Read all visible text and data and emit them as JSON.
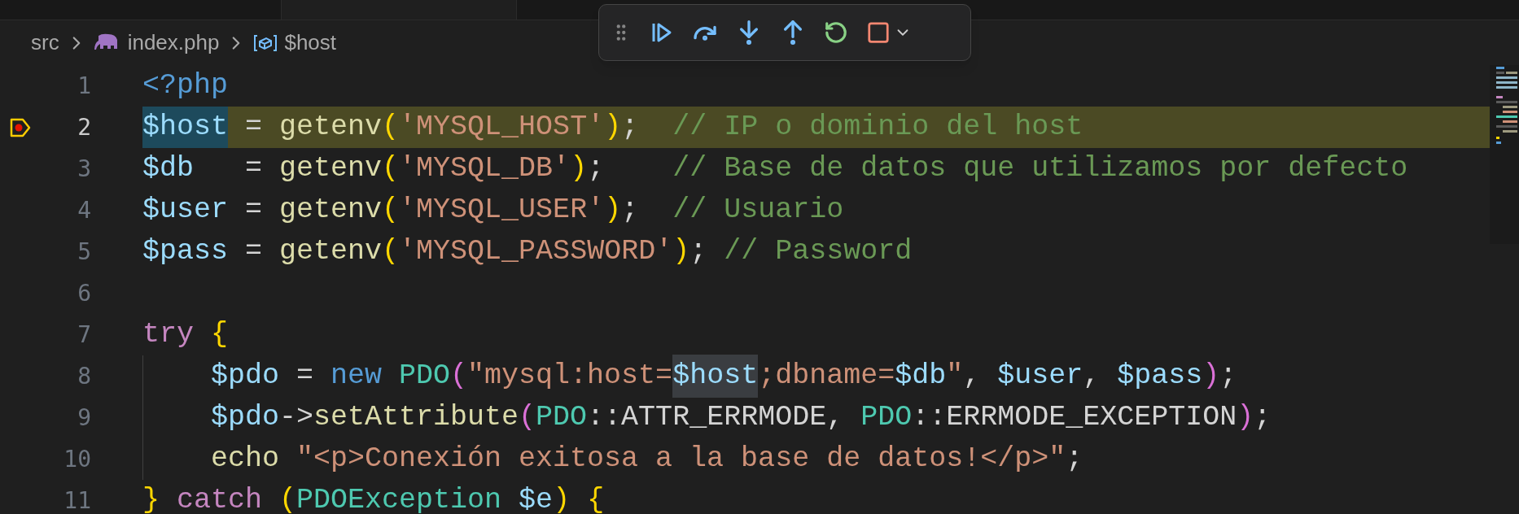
{
  "breadcrumb": [
    {
      "kind": "folder",
      "label": "src"
    },
    {
      "kind": "file",
      "label": "index.php"
    },
    {
      "kind": "symbol",
      "label": "$host"
    }
  ],
  "editor": {
    "lines": [
      {
        "number": "1",
        "current": false,
        "breakpoint": false,
        "indented": false,
        "tokens": [
          {
            "kind": "tag",
            "text": "<?php"
          }
        ]
      },
      {
        "number": "2",
        "current": true,
        "breakpoint": true,
        "indented": false,
        "tokens": [
          {
            "kind": "var",
            "text": "$host",
            "selected": true
          },
          {
            "kind": "plain",
            "text": " = "
          },
          {
            "kind": "fn",
            "text": "getenv"
          },
          {
            "kind": "paren",
            "text": "("
          },
          {
            "kind": "str",
            "text": "'MYSQL_HOST'"
          },
          {
            "kind": "paren",
            "text": ")"
          },
          {
            "kind": "plain",
            "text": ";  "
          },
          {
            "kind": "comment",
            "text": "// IP o dominio del host"
          }
        ]
      },
      {
        "number": "3",
        "current": false,
        "breakpoint": false,
        "indented": false,
        "tokens": [
          {
            "kind": "var",
            "text": "$db"
          },
          {
            "kind": "plain",
            "text": "   = "
          },
          {
            "kind": "fn",
            "text": "getenv"
          },
          {
            "kind": "paren",
            "text": "("
          },
          {
            "kind": "str",
            "text": "'MYSQL_DB'"
          },
          {
            "kind": "paren",
            "text": ")"
          },
          {
            "kind": "plain",
            "text": ";    "
          },
          {
            "kind": "comment",
            "text": "// Base de datos que utilizamos por defecto"
          }
        ]
      },
      {
        "number": "4",
        "current": false,
        "breakpoint": false,
        "indented": false,
        "tokens": [
          {
            "kind": "var",
            "text": "$user"
          },
          {
            "kind": "plain",
            "text": " = "
          },
          {
            "kind": "fn",
            "text": "getenv"
          },
          {
            "kind": "paren",
            "text": "("
          },
          {
            "kind": "str",
            "text": "'MYSQL_USER'"
          },
          {
            "kind": "paren",
            "text": ")"
          },
          {
            "kind": "plain",
            "text": ";  "
          },
          {
            "kind": "comment",
            "text": "// Usuario"
          }
        ]
      },
      {
        "number": "5",
        "current": false,
        "breakpoint": false,
        "indented": false,
        "tokens": [
          {
            "kind": "var",
            "text": "$pass"
          },
          {
            "kind": "plain",
            "text": " = "
          },
          {
            "kind": "fn",
            "text": "getenv"
          },
          {
            "kind": "paren",
            "text": "("
          },
          {
            "kind": "str",
            "text": "'MYSQL_PASSWORD'"
          },
          {
            "kind": "paren",
            "text": ")"
          },
          {
            "kind": "plain",
            "text": "; "
          },
          {
            "kind": "comment",
            "text": "// Password"
          }
        ]
      },
      {
        "number": "6",
        "current": false,
        "breakpoint": false,
        "indented": false
      },
      {
        "number": "7",
        "current": false,
        "breakpoint": false,
        "indented": false,
        "tokens": [
          {
            "kind": "control",
            "text": "try "
          },
          {
            "kind": "paren",
            "text": "{"
          }
        ]
      },
      {
        "number": "8",
        "current": false,
        "breakpoint": false,
        "indented": true,
        "tokens": [
          {
            "kind": "var",
            "text": "$pdo"
          },
          {
            "kind": "plain",
            "text": " = "
          },
          {
            "kind": "keyword",
            "text": "new "
          },
          {
            "kind": "class",
            "text": "PDO"
          },
          {
            "kind": "paren2",
            "text": "("
          },
          {
            "kind": "str",
            "text": "\"mysql:host="
          },
          {
            "kind": "var",
            "text": "$host",
            "selected": false
          },
          {
            "kind": "str",
            "text": ";dbname="
          },
          {
            "kind": "var",
            "text": "$db"
          },
          {
            "kind": "str",
            "text": "\""
          },
          {
            "kind": "plain",
            "text": ", "
          },
          {
            "kind": "var",
            "text": "$user"
          },
          {
            "kind": "plain",
            "text": ", "
          },
          {
            "kind": "var",
            "text": "$pass"
          },
          {
            "kind": "paren2",
            "text": ")"
          },
          {
            "kind": "plain",
            "text": ";"
          }
        ]
      },
      {
        "number": "9",
        "current": false,
        "breakpoint": false,
        "indented": true,
        "tokens": [
          {
            "kind": "var",
            "text": "$pdo"
          },
          {
            "kind": "plain",
            "text": "->"
          },
          {
            "kind": "fn",
            "text": "setAttribute"
          },
          {
            "kind": "paren2",
            "text": "("
          },
          {
            "kind": "class",
            "text": "PDO"
          },
          {
            "kind": "plain",
            "text": "::ATTR_ERRMODE, "
          },
          {
            "kind": "class",
            "text": "PDO"
          },
          {
            "kind": "plain",
            "text": "::ERRMODE_EXCEPTION"
          },
          {
            "kind": "paren2",
            "text": ")"
          },
          {
            "kind": "plain",
            "text": ";"
          }
        ]
      },
      {
        "number": "10",
        "current": false,
        "breakpoint": false,
        "indented": true,
        "tokens": [
          {
            "kind": "fn",
            "text": "echo "
          },
          {
            "kind": "str",
            "text": "\"<p>Conexión exitosa a la base de datos!</p>\""
          },
          {
            "kind": "plain",
            "text": ";"
          }
        ]
      },
      {
        "number": "11",
        "current": false,
        "breakpoint": false,
        "indented": false,
        "tokens": [
          {
            "kind": "paren",
            "text": "} "
          },
          {
            "kind": "control",
            "text": "catch "
          },
          {
            "kind": "paren",
            "text": "("
          },
          {
            "kind": "class",
            "text": "PDOException "
          },
          {
            "kind": "var",
            "text": "$e"
          },
          {
            "kind": "paren",
            "text": ") {"
          }
        ]
      }
    ]
  }
}
